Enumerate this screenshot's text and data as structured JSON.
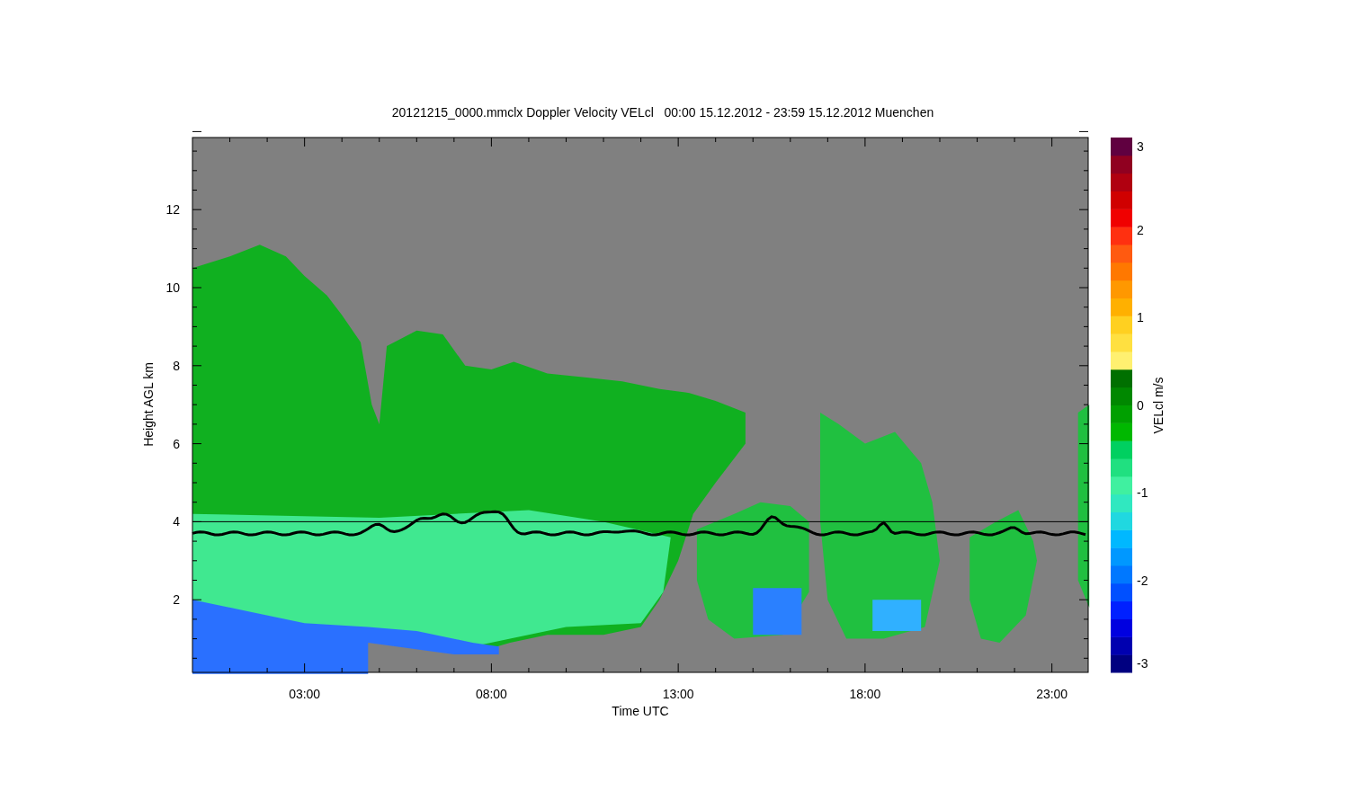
{
  "title": "20121215_0000.mmclx Doppler Velocity VELcl   00:00 15.12.2012 - 23:59 15.12.2012 Muenchen",
  "y_axis": {
    "label": "Height AGL km",
    "ticks": [
      "12",
      "10",
      "8",
      "6",
      "4",
      "2"
    ]
  },
  "x_axis": {
    "label": "Time UTC",
    "ticks": [
      "03:00",
      "08:00",
      "13:00",
      "18:00",
      "23:00"
    ]
  },
  "colorbar": {
    "label": "VELcl m/s",
    "ticks": [
      "3",
      "2",
      "1",
      "0",
      "-1",
      "-2",
      "-3"
    ]
  }
}
